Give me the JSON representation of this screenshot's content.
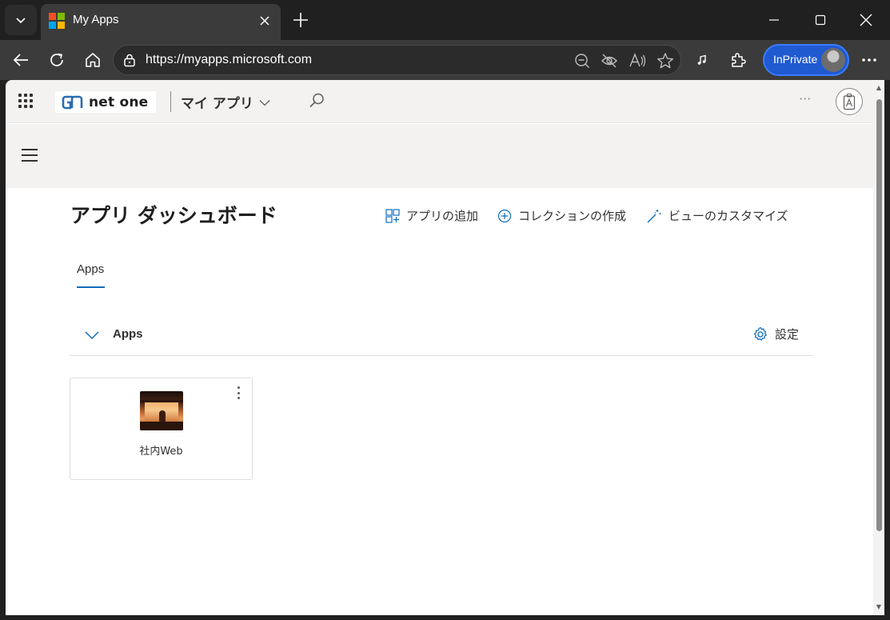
{
  "browser": {
    "tab_title": "My Apps",
    "url": "https://myapps.microsoft.com",
    "inprivate_label": "InPrivate",
    "favicon_colors": [
      "#f25022",
      "#7fba00",
      "#00a4ef",
      "#ffb900"
    ]
  },
  "header": {
    "brand": "net one",
    "app_switcher": "マイ アプリ",
    "more": "···"
  },
  "page": {
    "title": "アプリ ダッシュボード",
    "commands": {
      "add_app": "アプリの追加",
      "create_collection": "コレクションの作成",
      "customize_view": "ビューのカスタマイズ"
    },
    "tabs": [
      {
        "label": "Apps"
      }
    ],
    "section": {
      "title": "Apps",
      "settings": "設定"
    },
    "apps": [
      {
        "label": "社内Web"
      }
    ]
  },
  "colors": {
    "accent": "#0f6cbd",
    "inprivate": "#1f5ad1",
    "header_bg": "#f3f2f1"
  }
}
